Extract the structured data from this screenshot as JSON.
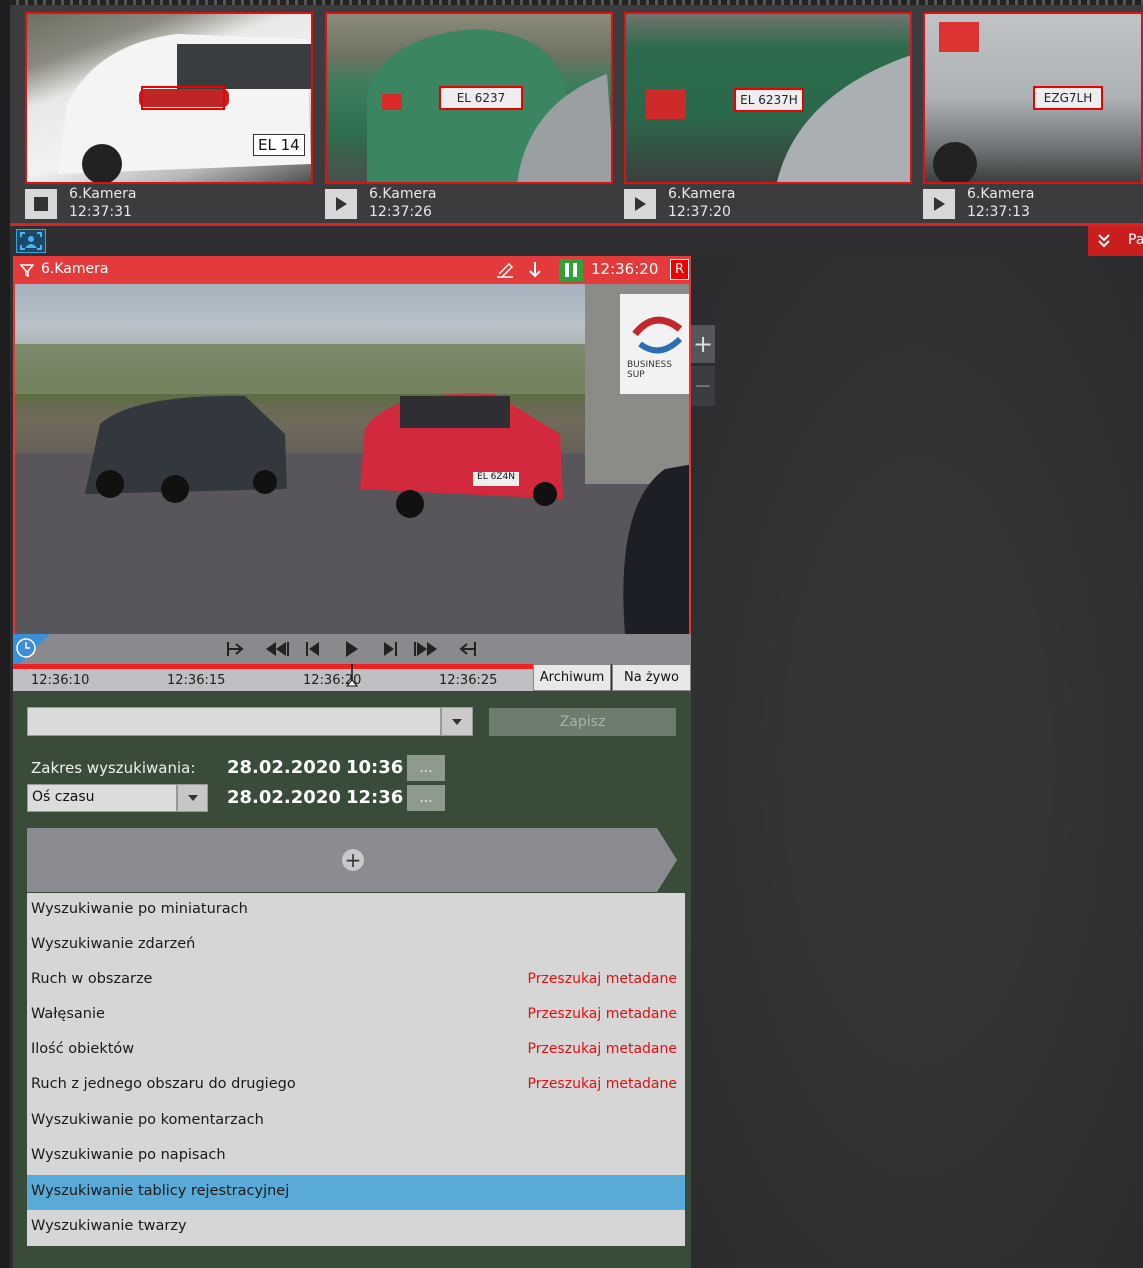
{
  "thumbnails": [
    {
      "camera": "6.Kamera",
      "time": "12:37:31",
      "plate": "EL 14",
      "state": "stop"
    },
    {
      "camera": "6.Kamera",
      "time": "12:37:26",
      "plate": "EL 6237",
      "state": "play"
    },
    {
      "camera": "6.Kamera",
      "time": "12:37:20",
      "plate": "EL 6237H",
      "state": "play"
    },
    {
      "camera": "6.Kamera",
      "time": "12:37:13",
      "plate": "EZG7LH",
      "state": "play"
    }
  ],
  "corner_button": {
    "label": "Pa"
  },
  "camera": {
    "title": "6.Kamera",
    "time": "12:36:20",
    "rec_label": "R",
    "plate_in_view": "EL 6Z4N",
    "sign_text": "BUSINESS SUP"
  },
  "timeline": {
    "ticks": [
      "12:36:10",
      "12:36:15",
      "12:36:20",
      "12:36:25"
    ],
    "archive_label": "Archiwum",
    "live_label": "Na żywo"
  },
  "search": {
    "preset_value": "",
    "save_label": "Zapisz",
    "range_label": "Zakres wyszukiwania:",
    "from_date": "28.02.2020",
    "from_time": "10:36",
    "to_date": "28.02.2020",
    "to_time": "12:36",
    "dots_label": "...",
    "mode_value": "Oś czasu",
    "add_symbol": "+"
  },
  "menu": {
    "items": [
      {
        "label": "Wyszukiwanie po miniaturach",
        "meta": ""
      },
      {
        "label": "Wyszukiwanie zdarzeń",
        "meta": ""
      },
      {
        "label": "Ruch w obszarze",
        "meta": "Przeszukaj metadane"
      },
      {
        "label": "Wałęsanie",
        "meta": "Przeszukaj metadane"
      },
      {
        "label": "Ilość obiektów",
        "meta": "Przeszukaj metadane"
      },
      {
        "label": "Ruch z jednego obszaru do drugiego",
        "meta": "Przeszukaj metadane"
      },
      {
        "label": "Wyszukiwanie po komentarzach",
        "meta": ""
      },
      {
        "label": "Wyszukiwanie po napisach",
        "meta": ""
      },
      {
        "label": "Wyszukiwanie tablicy rejestracyjnej",
        "meta": ""
      },
      {
        "label": "Wyszukiwanie twarzy",
        "meta": ""
      }
    ],
    "selected_index": 8
  },
  "zoom": {
    "plus": "+",
    "minus": "−"
  },
  "colors": {
    "accent_red": "#e33b3b",
    "selected_blue": "#5aaad8",
    "panel_green": "#394c39",
    "meta_red": "#e01010"
  }
}
